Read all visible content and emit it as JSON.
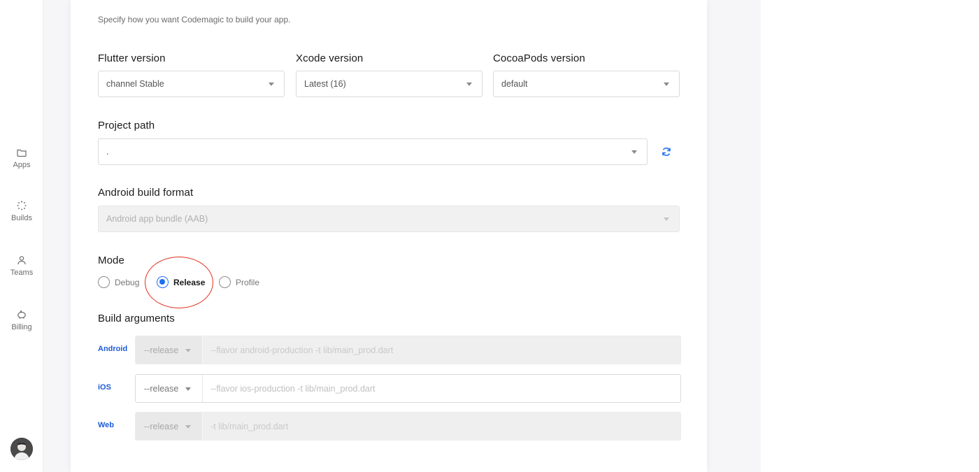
{
  "nav": {
    "items": [
      {
        "label": "Apps",
        "icon": "folder-icon"
      },
      {
        "label": "Builds",
        "icon": "builds-spinner-icon"
      },
      {
        "label": "Teams",
        "icon": "user-icon"
      },
      {
        "label": "Billing",
        "icon": "piggy-bank-icon"
      }
    ]
  },
  "build": {
    "subtitle": "Specify how you want Codemagic to build your app.",
    "flutter": {
      "label": "Flutter version",
      "value": "channel Stable"
    },
    "xcode": {
      "label": "Xcode version",
      "value": "Latest (16)"
    },
    "cocoapods": {
      "label": "CocoaPods version",
      "value": "default"
    },
    "project_path": {
      "label": "Project path",
      "value": "."
    },
    "android_format": {
      "label": "Android build format",
      "value": "Android app bundle (AAB)"
    },
    "mode": {
      "label": "Mode",
      "options": [
        "Debug",
        "Release",
        "Profile"
      ],
      "selected": "Release"
    },
    "arguments": {
      "label": "Build arguments",
      "rows": [
        {
          "platform": "Android",
          "mode": "--release",
          "placeholder": "--flavor android-production -t lib/main_prod.dart",
          "disabled": true
        },
        {
          "platform": "iOS",
          "mode": "--release",
          "placeholder": "--flavor ios-production -t lib/main_prod.dart",
          "disabled": false
        },
        {
          "platform": "Web",
          "mode": "--release",
          "placeholder": "-t lib/main_prod.dart",
          "disabled": true
        }
      ]
    }
  },
  "colors": {
    "accent": "#1d6ff2",
    "highlight": "#e0301e",
    "platform_label": "#1d5bd8"
  }
}
